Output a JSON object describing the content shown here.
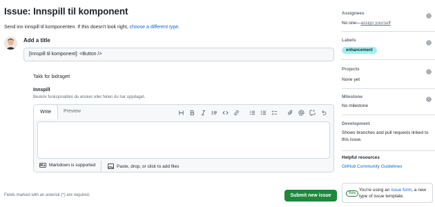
{
  "page": {
    "title": "Issue: Innspill til komponent",
    "subtitle_prefix": "Send inn innspill til komponenten. If this doesn't look right, ",
    "subtitle_link": "choose a different type",
    "subtitle_suffix": "."
  },
  "form": {
    "add_title_label": "Add a title",
    "title_value": "[Innspill til komponent]: <Button />",
    "body_text": "Takk for bidraget!",
    "field_label": "Innspill",
    "field_hint": "Beskriv funksjonaliten du ønsker eller feilen du har oppdaget.",
    "tabs": {
      "write": "Write",
      "preview": "Preview"
    },
    "toolbar_icons": [
      "heading-icon",
      "bold-icon",
      "italic-icon",
      "quote-icon",
      "code-icon",
      "link-icon",
      "numbered-list-icon",
      "unordered-list-icon",
      "task-list-icon",
      "attach-icon",
      "mention-icon",
      "cross-reference-icon",
      "undo-icon"
    ],
    "markdown_note": "Markdown is supported",
    "attach_note": "Paste, drop, or click to add files",
    "required_note": "Fields marked with an asterisk (*) are required.",
    "submit_label": "Submit new issue"
  },
  "sidebar": {
    "assignees": {
      "heading": "Assignees",
      "value_prefix": "No one—",
      "value_link": "assign yourself"
    },
    "labels": {
      "heading": "Labels",
      "pill": "enhancement",
      "pill_color": "#a2eeef"
    },
    "projects": {
      "heading": "Projects",
      "value": "None yet"
    },
    "milestone": {
      "heading": "Milestone",
      "value": "No milestone"
    },
    "development": {
      "heading": "Development",
      "value": "Shows branches and pull requests linked to this issue."
    },
    "helpful": {
      "heading": "Helpful resources",
      "link": "GitHub Community Guidelines"
    },
    "beta": {
      "badge": "Beta",
      "text_prefix": "You're using an ",
      "text_link": "issue form",
      "text_suffix": ", a new type of issue template."
    }
  },
  "colors": {
    "accent": "#0969da",
    "submit": "#1f883d",
    "border": "#d0d7de"
  }
}
